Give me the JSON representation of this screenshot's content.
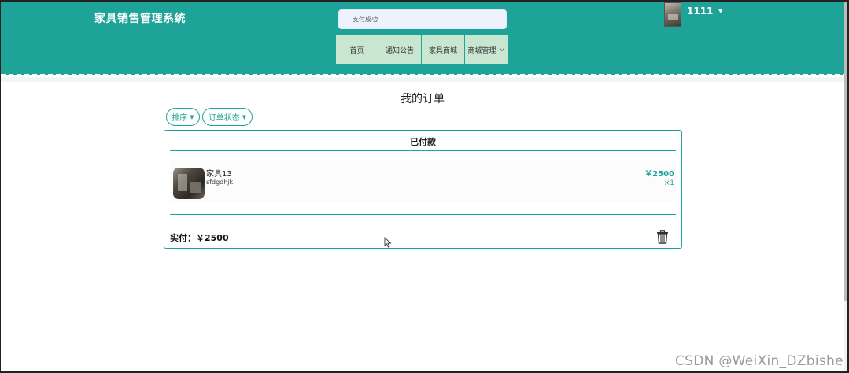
{
  "app": {
    "title": "家具销售管理系统"
  },
  "toast": {
    "message": "支付成功"
  },
  "nav": {
    "items": [
      {
        "label": "首页"
      },
      {
        "label": "通知公告"
      },
      {
        "label": "家具商城"
      },
      {
        "label": "商城管理"
      }
    ],
    "dropdown_icon": "chevron-down-icon"
  },
  "user": {
    "name": "1111",
    "caret_icon": "caret-down-icon"
  },
  "page": {
    "title": "我的订单"
  },
  "filters": {
    "sort_label": "排序",
    "status_label": "订单状态"
  },
  "order": {
    "status": "已付款",
    "item": {
      "name": "家具13",
      "description": "sfdgdhjk",
      "price": "￥2500",
      "quantity": "×1"
    },
    "paid_label": "实付：",
    "paid_amount": "￥2500",
    "delete_icon": "trash-icon"
  },
  "watermark": "CSDN @WeiXin_DZbishe",
  "colors": {
    "primary": "#1ea399",
    "nav_item_bg": "#c9e6d1",
    "toast_bg": "#edf2fc"
  }
}
